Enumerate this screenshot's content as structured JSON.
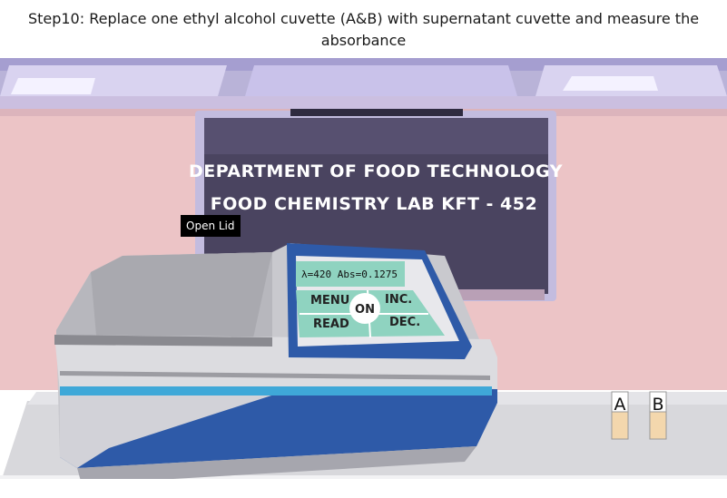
{
  "instruction": {
    "text": "Step10: Replace one ethyl alcohol cuvette (A&B) with supernatant cuvette and measure the absorbance"
  },
  "board": {
    "line1": "DEPARTMENT OF FOOD TECHNOLOGY",
    "line2": "FOOD CHEMISTRY LAB KFT - 452"
  },
  "spectrophotometer": {
    "display": "λ=420 Abs=0.1275",
    "buttons": {
      "menu": "MENU",
      "inc": "INC.",
      "on": "ON",
      "read": "READ",
      "dec": "DEC."
    },
    "open_lid_label": "Open Lid"
  },
  "cuvettes": {
    "a_label": "A",
    "b_label": "B"
  },
  "colors": {
    "wall": "#ecc4c6",
    "board": "#4a4460",
    "device_blue": "#2e5aa8",
    "panel_teal": "#8fd3c0",
    "bench": "#d8d8dc"
  }
}
